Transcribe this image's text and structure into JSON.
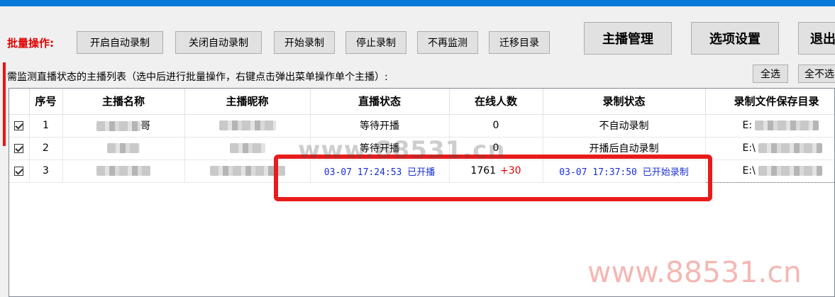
{
  "toolbar": {
    "batch_label": "批量操作:",
    "buttons": [
      "开启自动录制",
      "关闭自动录制",
      "开始录制",
      "停止录制",
      "不再监测",
      "迁移目录"
    ],
    "big_buttons": [
      "主播管理",
      "选项设置",
      "退出"
    ]
  },
  "list": {
    "description": "需监测直播状态的主播列表（选中后进行批量操作，右键点击弹出菜单操作单个主播）:",
    "select_all": "全选",
    "select_none": "全不选"
  },
  "table": {
    "headers": [
      "序号",
      "主播名称",
      "主播昵称",
      "直播状态",
      "在线人数",
      "录制状态",
      "录制文件保存目录"
    ],
    "rows": [
      {
        "index": "1",
        "name_tail": "哥",
        "live_status": "等待开播",
        "online": "0",
        "online_delta": "",
        "record_status": "不自动录制",
        "save_dir": "E:"
      },
      {
        "index": "2",
        "name_tail": "",
        "live_status": "等待开播",
        "online": "0",
        "online_delta": "",
        "record_status": "开播后自动录制",
        "save_dir": "E:\\"
      },
      {
        "index": "3",
        "name_tail": "",
        "live_status": "03-07 17:24:53 已开播",
        "online": "1761",
        "online_delta": "+30",
        "record_status": "03-07 17:37:50 已开始录制",
        "save_dir": "E:\\"
      }
    ]
  },
  "watermarks": {
    "middle": "www.88531.cn",
    "bottom": "www.88531.cn"
  },
  "colors": {
    "title_bar": "#0a78d7",
    "batch_label": "#e00000",
    "live_text": "#1a2fd6",
    "highlight_box": "#e81b1b",
    "delta": "#e00000"
  }
}
